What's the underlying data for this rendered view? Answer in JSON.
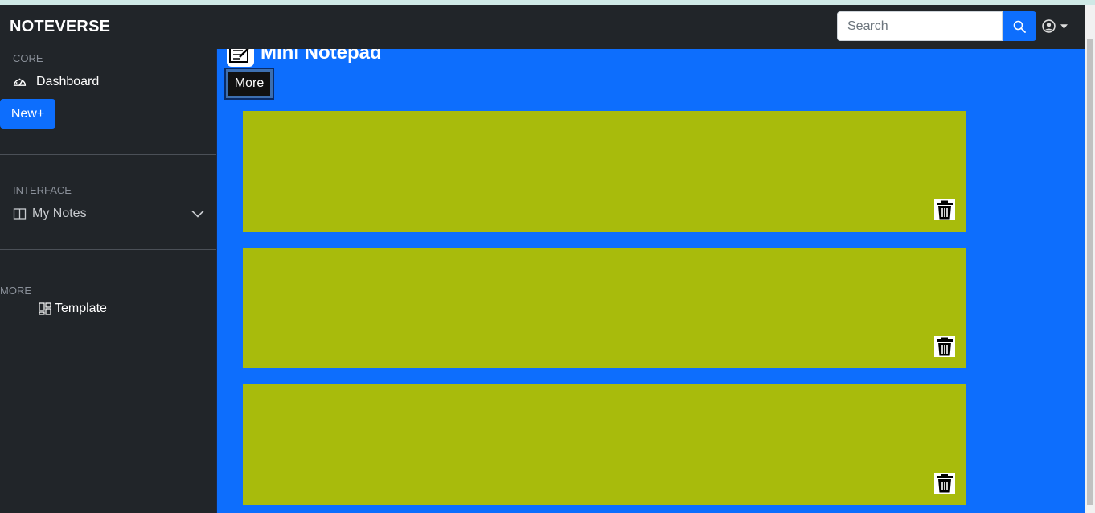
{
  "app": {
    "brand": "NOTEVERSE",
    "accent_color": "#0d6efd",
    "note_color": "#a8bb0c"
  },
  "search": {
    "placeholder": "Search",
    "value": "",
    "icon": "search-icon"
  },
  "user_menu": {
    "icon": "user-circle-icon",
    "caret": "caret-down-icon"
  },
  "sidebar": {
    "core_heading": "CORE",
    "dashboard_label": "Dashboard",
    "dashboard_icon": "speedometer-icon",
    "new_button": "New+",
    "interface_heading": "INTERFACE",
    "my_notes_label": "My Notes",
    "my_notes_icon": "columns-icon",
    "more_heading": "MORE",
    "template_label": "Template",
    "template_icon": "layout-icon"
  },
  "main": {
    "title": "Mini Notepad",
    "title_icon": "notepad-icon",
    "more_button": "More",
    "notes": [
      {
        "text": "",
        "delete_icon": "trash-icon"
      },
      {
        "text": "",
        "delete_icon": "trash-icon"
      },
      {
        "text": "",
        "delete_icon": "trash-icon"
      }
    ]
  }
}
